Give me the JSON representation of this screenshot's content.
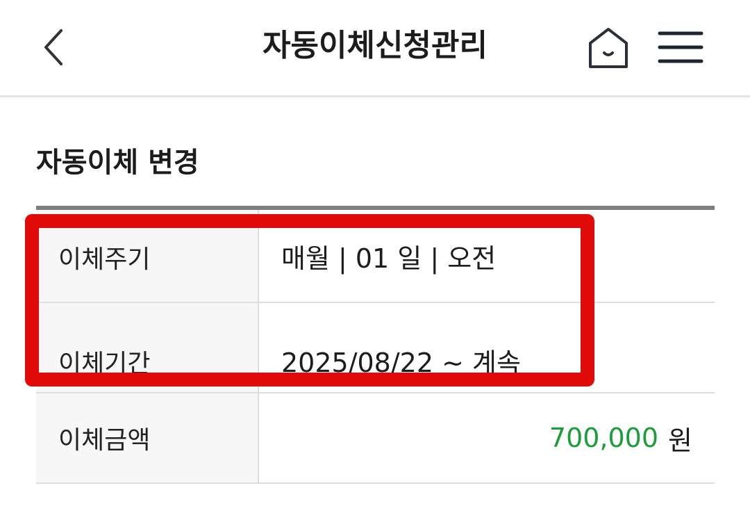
{
  "header": {
    "title": "자동이체신청관리",
    "back_icon": "chevron-left-icon",
    "home_icon": "home-icon",
    "menu_icon": "hamburger-menu-icon"
  },
  "section": {
    "title": "자동이체 변경"
  },
  "rows": [
    {
      "label": "이체주기",
      "value": "매월 | 01 일 | 오전"
    },
    {
      "label": "이체기간",
      "value": "2025/08/22 ~ 계속"
    },
    {
      "label": "이체금액",
      "amount": "700,000",
      "unit": "원"
    }
  ],
  "colors": {
    "amount": "#1a9e3a",
    "highlight": "#e20b0b",
    "divider": "#dddddd",
    "label_bg": "#f7f7f7"
  }
}
